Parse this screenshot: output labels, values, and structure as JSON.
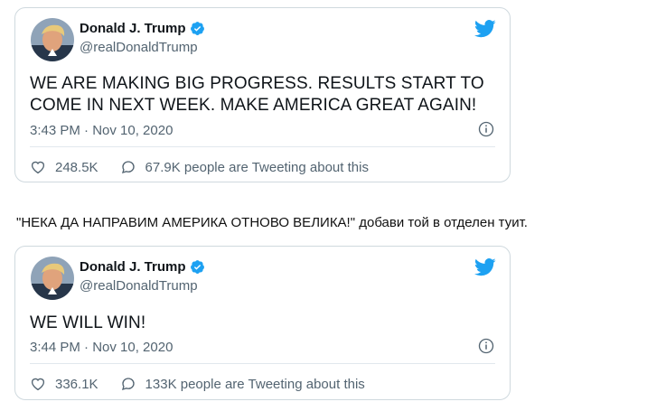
{
  "tweets": [
    {
      "name": "Donald J. Trump",
      "handle": "@realDonaldTrump",
      "text": "WE ARE MAKING BIG PROGRESS. RESULTS START TO COME IN NEXT WEEK. MAKE AMERICA GREAT AGAIN!",
      "timestamp": "3:43 PM · Nov 10, 2020",
      "likes": "248.5K",
      "conversation": "67.9K people are Tweeting about this"
    },
    {
      "name": "Donald J. Trump",
      "handle": "@realDonaldTrump",
      "text": "WE WILL WIN!",
      "timestamp": "3:44 PM · Nov 10, 2020",
      "likes": "336.1K",
      "conversation": "133K people are Tweeting about this"
    }
  ],
  "caption": "\"НЕКА ДА НАПРАВИМ АМЕРИКА ОТНОВО ВЕЛИКА!\" добави той в отделен туит.",
  "icons": {
    "verified": "verified-badge-icon",
    "twitter": "twitter-bird-icon",
    "info": "info-icon",
    "like": "heart-icon",
    "conversation": "speech-bubble-icon"
  },
  "colors": {
    "twitter_blue": "#1da1f2",
    "secondary_text": "#536471",
    "border": "#cfd9de"
  }
}
